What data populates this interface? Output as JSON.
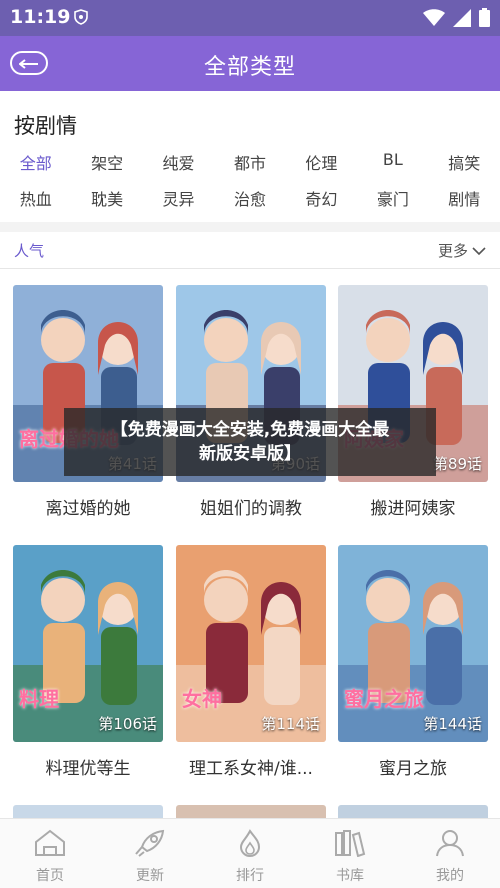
{
  "status": {
    "time": "11:19"
  },
  "header": {
    "title": "全部类型"
  },
  "filter": {
    "heading": "按剧情",
    "row1": [
      "全部",
      "架空",
      "纯爱",
      "都市",
      "伦理",
      "BL",
      "搞笑"
    ],
    "row2": [
      "热血",
      "耽美",
      "灵异",
      "治愈",
      "奇幻",
      "豪门",
      "剧情"
    ],
    "active": "全部"
  },
  "list": {
    "section_label": "人气",
    "more_label": "更多"
  },
  "comics": [
    {
      "title": "离过婚的她",
      "chapters": "第41话",
      "cover_text": "离过婚的她",
      "palette": [
        "#8fb0d8",
        "#c7564b",
        "#3d5e8f"
      ]
    },
    {
      "title": "姐姐们的调教",
      "chapters": "第90话",
      "cover_text": "",
      "palette": [
        "#9ec7e8",
        "#e8c9b4",
        "#3a3f6a"
      ]
    },
    {
      "title": "搬进阿姨家",
      "chapters": "第89话",
      "cover_text": "阿姨家",
      "palette": [
        "#d8dfe8",
        "#2f4f9a",
        "#c86a5a"
      ]
    },
    {
      "title": "料理优等生",
      "chapters": "第106话",
      "cover_text": "料理",
      "palette": [
        "#5aa0c8",
        "#e9b27a",
        "#3c7a3c"
      ]
    },
    {
      "title": "理工系女神/谁...",
      "chapters": "第114话",
      "cover_text": "女神",
      "palette": [
        "#e9a070",
        "#8a2a3a",
        "#f3d7c4"
      ]
    },
    {
      "title": "蜜月之旅",
      "chapters": "第144话",
      "cover_text": "蜜月之旅",
      "palette": [
        "#7fb3d8",
        "#d89a7a",
        "#4a6fa8"
      ]
    }
  ],
  "overlay": {
    "line1": "【免费漫画大全安装,免费漫画大全最",
    "line2": "新版安卓版】"
  },
  "nav": [
    {
      "label": "首页",
      "icon": "home-icon"
    },
    {
      "label": "更新",
      "icon": "rocket-icon"
    },
    {
      "label": "排行",
      "icon": "flame-icon"
    },
    {
      "label": "书库",
      "icon": "books-icon"
    },
    {
      "label": "我的",
      "icon": "user-icon"
    }
  ],
  "colors": {
    "accent": "#8665d6",
    "active_tag": "#6a5acd"
  }
}
